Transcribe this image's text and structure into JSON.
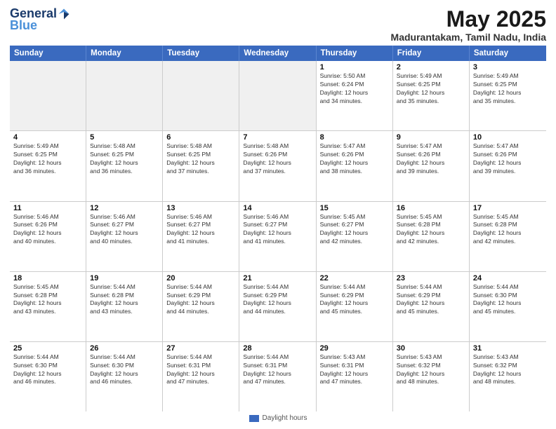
{
  "header": {
    "logo_line1": "General",
    "logo_line2": "Blue",
    "month_title": "May 2025",
    "location": "Madurantakam, Tamil Nadu, India"
  },
  "weekdays": [
    "Sunday",
    "Monday",
    "Tuesday",
    "Wednesday",
    "Thursday",
    "Friday",
    "Saturday"
  ],
  "weeks": [
    [
      {
        "day": "",
        "info": "",
        "shaded": true
      },
      {
        "day": "",
        "info": "",
        "shaded": true
      },
      {
        "day": "",
        "info": "",
        "shaded": true
      },
      {
        "day": "",
        "info": "",
        "shaded": true
      },
      {
        "day": "1",
        "info": "Sunrise: 5:50 AM\nSunset: 6:24 PM\nDaylight: 12 hours\nand 34 minutes."
      },
      {
        "day": "2",
        "info": "Sunrise: 5:49 AM\nSunset: 6:25 PM\nDaylight: 12 hours\nand 35 minutes."
      },
      {
        "day": "3",
        "info": "Sunrise: 5:49 AM\nSunset: 6:25 PM\nDaylight: 12 hours\nand 35 minutes.",
        "shaded": false
      }
    ],
    [
      {
        "day": "4",
        "info": "Sunrise: 5:49 AM\nSunset: 6:25 PM\nDaylight: 12 hours\nand 36 minutes."
      },
      {
        "day": "5",
        "info": "Sunrise: 5:48 AM\nSunset: 6:25 PM\nDaylight: 12 hours\nand 36 minutes."
      },
      {
        "day": "6",
        "info": "Sunrise: 5:48 AM\nSunset: 6:25 PM\nDaylight: 12 hours\nand 37 minutes."
      },
      {
        "day": "7",
        "info": "Sunrise: 5:48 AM\nSunset: 6:26 PM\nDaylight: 12 hours\nand 37 minutes."
      },
      {
        "day": "8",
        "info": "Sunrise: 5:47 AM\nSunset: 6:26 PM\nDaylight: 12 hours\nand 38 minutes."
      },
      {
        "day": "9",
        "info": "Sunrise: 5:47 AM\nSunset: 6:26 PM\nDaylight: 12 hours\nand 39 minutes."
      },
      {
        "day": "10",
        "info": "Sunrise: 5:47 AM\nSunset: 6:26 PM\nDaylight: 12 hours\nand 39 minutes."
      }
    ],
    [
      {
        "day": "11",
        "info": "Sunrise: 5:46 AM\nSunset: 6:26 PM\nDaylight: 12 hours\nand 40 minutes."
      },
      {
        "day": "12",
        "info": "Sunrise: 5:46 AM\nSunset: 6:27 PM\nDaylight: 12 hours\nand 40 minutes."
      },
      {
        "day": "13",
        "info": "Sunrise: 5:46 AM\nSunset: 6:27 PM\nDaylight: 12 hours\nand 41 minutes."
      },
      {
        "day": "14",
        "info": "Sunrise: 5:46 AM\nSunset: 6:27 PM\nDaylight: 12 hours\nand 41 minutes."
      },
      {
        "day": "15",
        "info": "Sunrise: 5:45 AM\nSunset: 6:27 PM\nDaylight: 12 hours\nand 42 minutes."
      },
      {
        "day": "16",
        "info": "Sunrise: 5:45 AM\nSunset: 6:28 PM\nDaylight: 12 hours\nand 42 minutes."
      },
      {
        "day": "17",
        "info": "Sunrise: 5:45 AM\nSunset: 6:28 PM\nDaylight: 12 hours\nand 42 minutes."
      }
    ],
    [
      {
        "day": "18",
        "info": "Sunrise: 5:45 AM\nSunset: 6:28 PM\nDaylight: 12 hours\nand 43 minutes."
      },
      {
        "day": "19",
        "info": "Sunrise: 5:44 AM\nSunset: 6:28 PM\nDaylight: 12 hours\nand 43 minutes."
      },
      {
        "day": "20",
        "info": "Sunrise: 5:44 AM\nSunset: 6:29 PM\nDaylight: 12 hours\nand 44 minutes."
      },
      {
        "day": "21",
        "info": "Sunrise: 5:44 AM\nSunset: 6:29 PM\nDaylight: 12 hours\nand 44 minutes."
      },
      {
        "day": "22",
        "info": "Sunrise: 5:44 AM\nSunset: 6:29 PM\nDaylight: 12 hours\nand 45 minutes."
      },
      {
        "day": "23",
        "info": "Sunrise: 5:44 AM\nSunset: 6:29 PM\nDaylight: 12 hours\nand 45 minutes."
      },
      {
        "day": "24",
        "info": "Sunrise: 5:44 AM\nSunset: 6:30 PM\nDaylight: 12 hours\nand 45 minutes."
      }
    ],
    [
      {
        "day": "25",
        "info": "Sunrise: 5:44 AM\nSunset: 6:30 PM\nDaylight: 12 hours\nand 46 minutes."
      },
      {
        "day": "26",
        "info": "Sunrise: 5:44 AM\nSunset: 6:30 PM\nDaylight: 12 hours\nand 46 minutes."
      },
      {
        "day": "27",
        "info": "Sunrise: 5:44 AM\nSunset: 6:31 PM\nDaylight: 12 hours\nand 47 minutes."
      },
      {
        "day": "28",
        "info": "Sunrise: 5:44 AM\nSunset: 6:31 PM\nDaylight: 12 hours\nand 47 minutes."
      },
      {
        "day": "29",
        "info": "Sunrise: 5:43 AM\nSunset: 6:31 PM\nDaylight: 12 hours\nand 47 minutes."
      },
      {
        "day": "30",
        "info": "Sunrise: 5:43 AM\nSunset: 6:32 PM\nDaylight: 12 hours\nand 48 minutes."
      },
      {
        "day": "31",
        "info": "Sunrise: 5:43 AM\nSunset: 6:32 PM\nDaylight: 12 hours\nand 48 minutes."
      }
    ]
  ],
  "footer": {
    "daylight_label": "Daylight hours"
  }
}
